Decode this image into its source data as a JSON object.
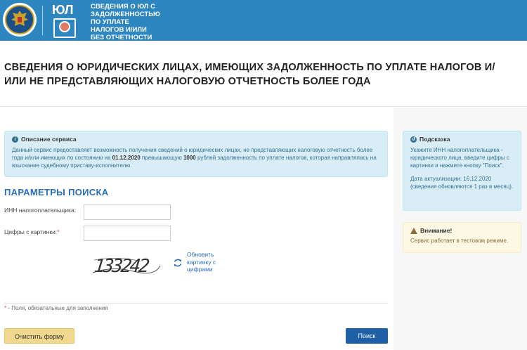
{
  "header": {
    "emblem_text": "ФЕДЕРАЛЬНАЯ НАЛОГОВАЯ СЛУЖБА",
    "service_logo_text": "ЮЛ",
    "service_title": "СВЕДЕНИЯ О ЮЛ С ЗАДОЛЖЕННОСТЬЮ ПО УПЛАТЕ НАЛОГОВ И/ИЛИ БЕЗ ОТЧЕТНОСТИ БОЛЕЕ ГОДА"
  },
  "page_title": "СВЕДЕНИЯ О ЮРИДИЧЕСКИХ ЛИЦАХ, ИМЕЮЩИХ ЗАДОЛЖЕННОСТЬ ПО УПЛАТЕ НАЛОГОВ И/ИЛИ НЕ ПРЕДСТАВЛЯЮЩИХ НАЛОГОВУЮ ОТЧЕТНОСТЬ БОЛЕЕ ГОДА",
  "info": {
    "title": "Описание сервиса",
    "text_1": "Данный сервис предоставляет возможность получения сведений о юридических лицах, не представляющих налоговую отчетность более года и/или имеющих по состоянию на ",
    "date": "01.12.2020",
    "text_2": " превышающую ",
    "amount": "1000",
    "text_3": " рублей задолженность по уплате налогов, которая направлялась на взыскание судебному приставу-исполнителю."
  },
  "search": {
    "title": "ПАРАМЕТРЫ ПОИСКА",
    "inn_label": "ИНН налогоплательщика:",
    "inn_value": "",
    "captcha_label": "Цифры с картинки:",
    "required_mark": "*",
    "captcha_value": "",
    "captcha_digits": "133242",
    "refresh_label": "Обновить картинку с цифрами",
    "required_note_mark": "*",
    "required_note": " - Поля, обязательные для заполнения",
    "clear_label": "Очистить форму",
    "search_label": "Поиск"
  },
  "hint": {
    "title": "Подсказка",
    "text": "Укажите ИНН налогоплательщика - юридического лица, введите цифры с картинки и нажмите кнопку \"Поиск\".",
    "update_text": "Дата актуализации: 16.12.2020 (сведения обновляются 1 раз в месяц)."
  },
  "warning": {
    "title": "Внимание!",
    "text": "Сервис работает в тестовом режиме."
  },
  "colors": {
    "header_bg": "#2e86c1",
    "accent_blue": "#2a6ebb",
    "info_bg": "#d9edf7",
    "warning_bg": "#fcf8e3",
    "clear_button": "#f0d88e",
    "search_button": "#1f5fa6"
  }
}
